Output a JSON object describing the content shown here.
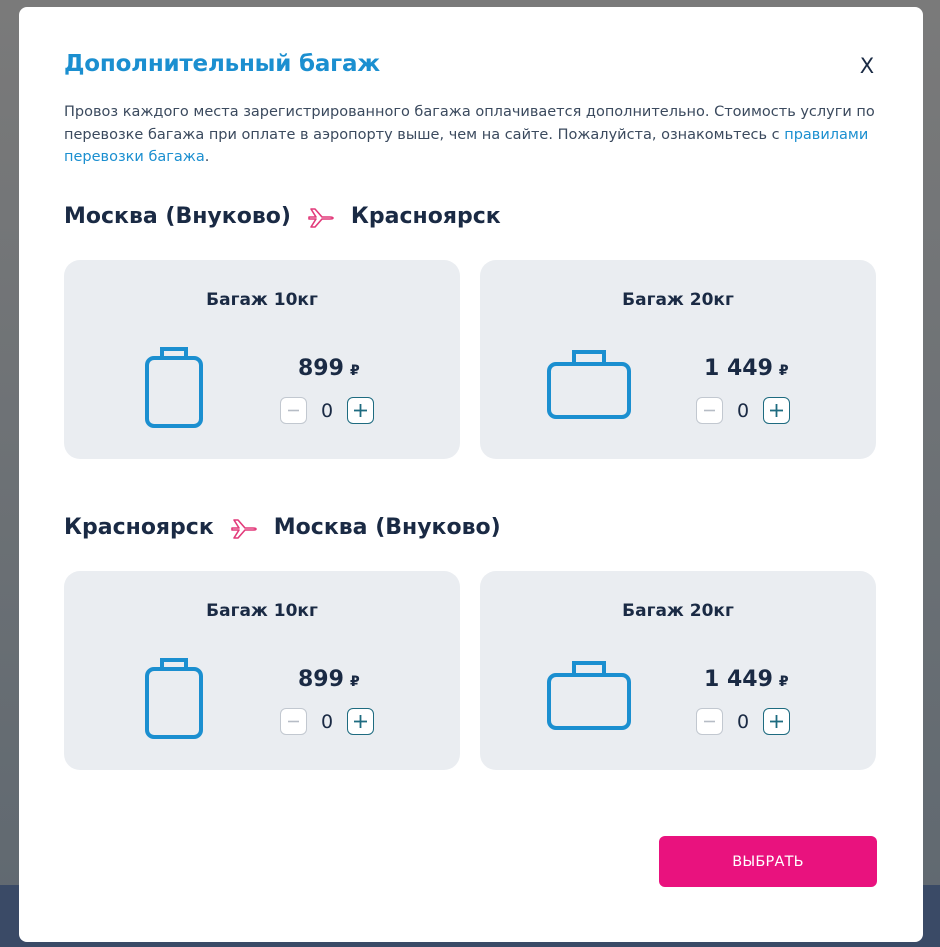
{
  "modal": {
    "title": "Дополнительный багаж",
    "close_label": "X",
    "intro_text": "Провоз каждого места зарегистрированного багажа оплачивается дополнительно. Стоимость услуги по перевозке багажа при оплате в аэропорту выше, чем на сайте. Пожалуйста, ознакомьтесь с ",
    "intro_link": "правилами перевозки багажа",
    "intro_end": "."
  },
  "segments": [
    {
      "from": "Москва (Внуково)",
      "to": "Красноярск",
      "options": [
        {
          "title": "Багаж 10кг",
          "price": "899",
          "currency": "₽",
          "quantity": "0",
          "icon": "suitcase-vertical-icon"
        },
        {
          "title": "Багаж 20кг",
          "price": "1 449",
          "currency": "₽",
          "quantity": "0",
          "icon": "suitcase-horizontal-icon"
        }
      ]
    },
    {
      "from": "Красноярск",
      "to": "Москва (Внуково)",
      "options": [
        {
          "title": "Багаж 10кг",
          "price": "899",
          "currency": "₽",
          "quantity": "0",
          "icon": "suitcase-vertical-icon"
        },
        {
          "title": "Багаж 20кг",
          "price": "1 449",
          "currency": "₽",
          "quantity": "0",
          "icon": "suitcase-horizontal-icon"
        }
      ]
    }
  ],
  "actions": {
    "choose_label": "ВЫБРАТЬ"
  },
  "colors": {
    "accent": "#1b8fd0",
    "button": "#e9127e",
    "card_bg": "#eaedf1",
    "text": "#1a2a44"
  }
}
